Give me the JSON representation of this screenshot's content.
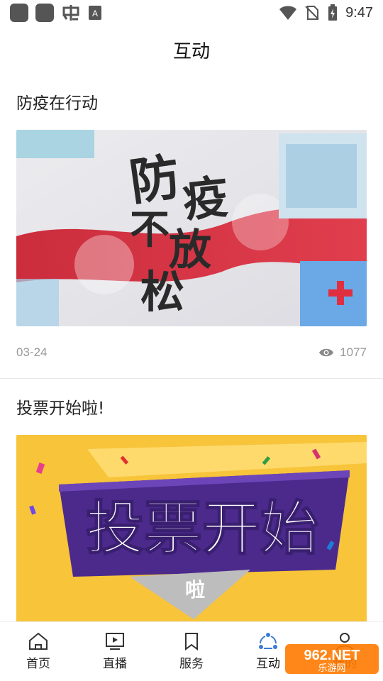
{
  "status_bar": {
    "time": "9:47"
  },
  "header": {
    "title": "互动"
  },
  "posts": [
    {
      "title": "防疫在行动",
      "date": "03-24",
      "views": "1077",
      "image_text": [
        "防",
        "疫",
        "不",
        "放",
        "松"
      ]
    },
    {
      "title": "投票开始啦!",
      "image_text": [
        "投票开始",
        "啦"
      ]
    }
  ],
  "tabs": [
    {
      "label": "首页",
      "icon": "home-icon"
    },
    {
      "label": "直播",
      "icon": "tv-play-icon"
    },
    {
      "label": "服务",
      "icon": "bookmark-icon"
    },
    {
      "label": "互动",
      "icon": "share-nodes-icon"
    },
    {
      "label": "我的",
      "icon": "person-icon"
    }
  ],
  "watermark": {
    "brand": "962.NET",
    "sub": "乐游网"
  },
  "colors": {
    "accent": "#3a7bd5",
    "text": "#222222",
    "meta": "#999999"
  }
}
